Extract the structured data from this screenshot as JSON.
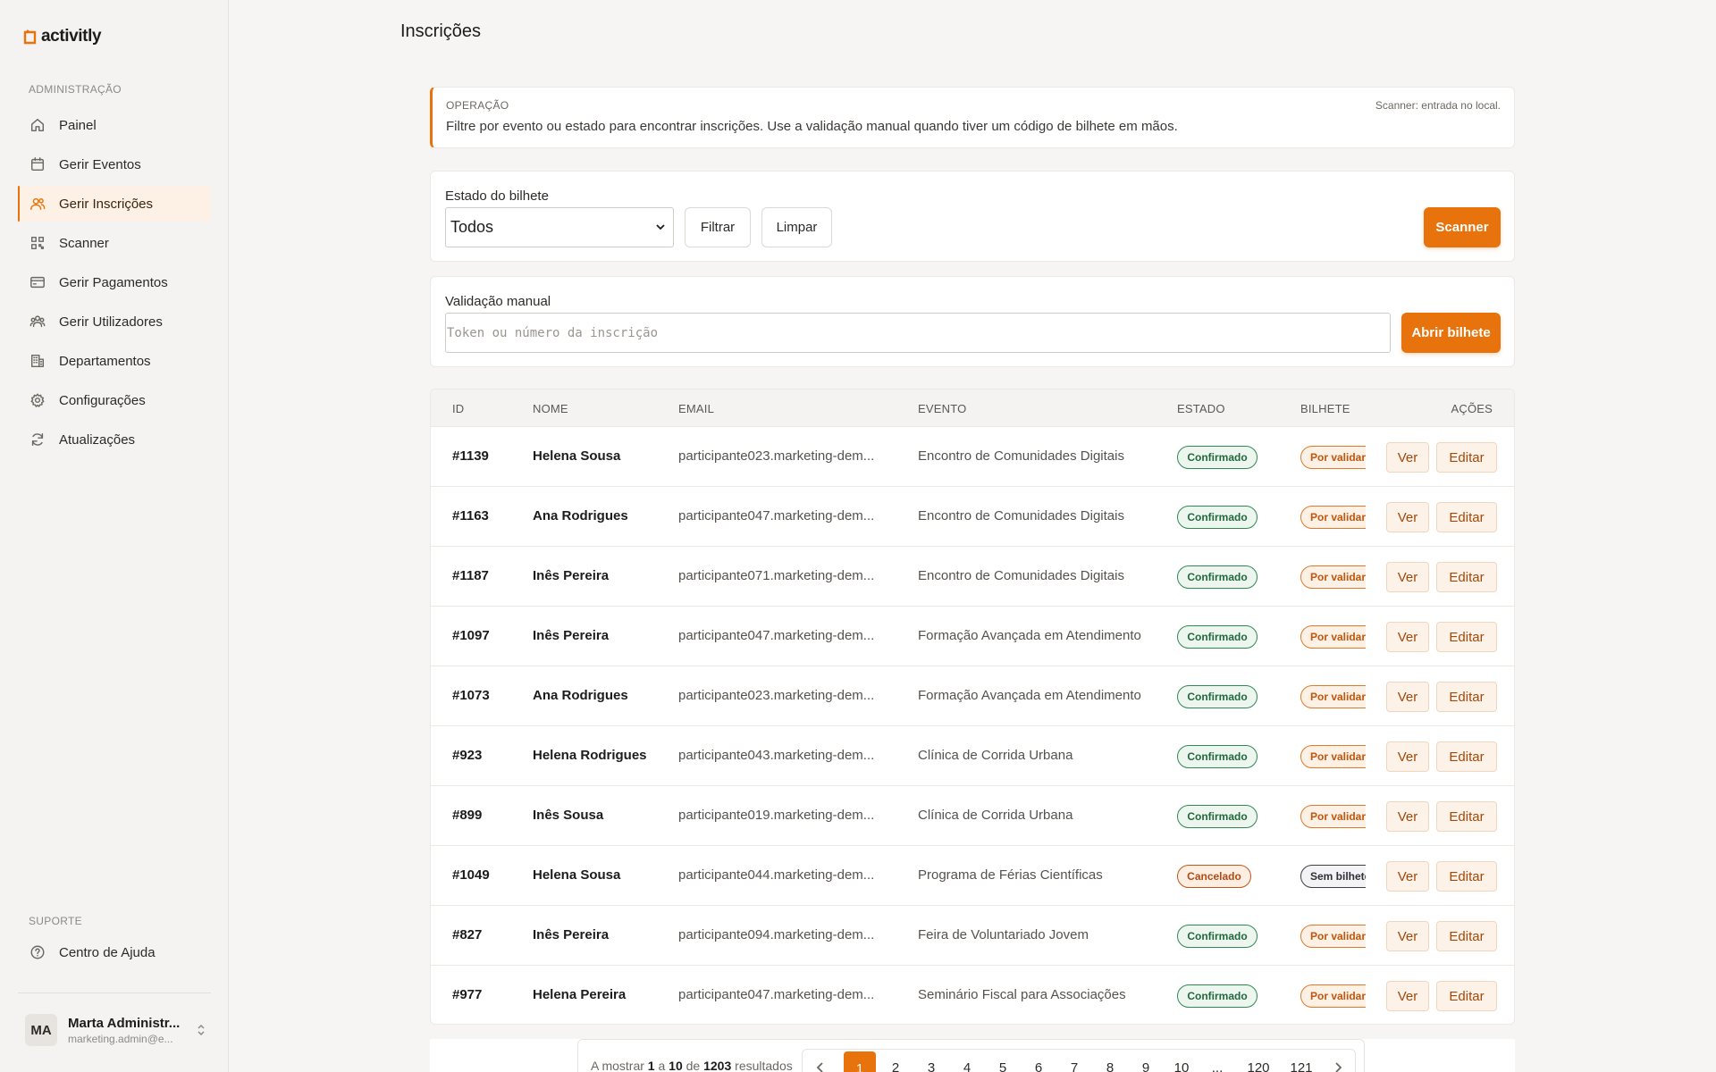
{
  "brand": {
    "name": "activitly",
    "accent": "#e8720c"
  },
  "sidebar": {
    "admin_label": "ADMINISTRAÇÃO",
    "items": [
      {
        "label": "Painel",
        "icon": "home-icon"
      },
      {
        "label": "Gerir Eventos",
        "icon": "calendar-icon"
      },
      {
        "label": "Gerir Inscrições",
        "icon": "users-icon"
      },
      {
        "label": "Scanner",
        "icon": "qr-icon"
      },
      {
        "label": "Gerir Pagamentos",
        "icon": "credit-card-icon"
      },
      {
        "label": "Gerir Utilizadores",
        "icon": "user-group-icon"
      },
      {
        "label": "Departamentos",
        "icon": "building-icon"
      },
      {
        "label": "Configurações",
        "icon": "gear-icon"
      },
      {
        "label": "Atualizações",
        "icon": "refresh-icon"
      }
    ],
    "support_label": "SUPORTE",
    "help": {
      "label": "Centro de Ajuda",
      "icon": "help-circle-icon"
    },
    "user": {
      "initials": "MA",
      "name": "Marta Administr...",
      "email": "marketing.admin@e..."
    }
  },
  "page": {
    "title": "Inscrições"
  },
  "operation": {
    "label": "OPERAÇÃO",
    "text": "Filtre por evento ou estado para encontrar inscrições. Use a validação manual quando tiver um código de bilhete em mãos.",
    "note": "Scanner: entrada no local."
  },
  "filter": {
    "label": "Estado do bilhete",
    "selected": "Todos",
    "filter_button": "Filtrar",
    "clear_button": "Limpar",
    "scanner_button": "Scanner"
  },
  "validation": {
    "label": "Validação manual",
    "placeholder": "Token ou número da inscrição",
    "button": "Abrir bilhete"
  },
  "table": {
    "headers": {
      "id": "ID",
      "name": "NOME",
      "email": "EMAIL",
      "event": "EVENTO",
      "status": "ESTADO",
      "ticket": "BILHETE",
      "actions": "AÇÕES"
    },
    "view_label": "Ver",
    "edit_label": "Editar",
    "rows": [
      {
        "id": "#1139",
        "name": "Helena Sousa",
        "email": "participante023.marketing-dem...",
        "event": "Encontro de Comunidades Digitais",
        "status": "Confirmado",
        "status_type": "ok",
        "ticket": "Por validar",
        "ticket_type": "pending"
      },
      {
        "id": "#1163",
        "name": "Ana Rodrigues",
        "email": "participante047.marketing-dem...",
        "event": "Encontro de Comunidades Digitais",
        "status": "Confirmado",
        "status_type": "ok",
        "ticket": "Por validar",
        "ticket_type": "pending"
      },
      {
        "id": "#1187",
        "name": "Inês Pereira",
        "email": "participante071.marketing-dem...",
        "event": "Encontro de Comunidades Digitais",
        "status": "Confirmado",
        "status_type": "ok",
        "ticket": "Por validar",
        "ticket_type": "pending"
      },
      {
        "id": "#1097",
        "name": "Inês Pereira",
        "email": "participante047.marketing-dem...",
        "event": "Formação Avançada em Atendimento",
        "status": "Confirmado",
        "status_type": "ok",
        "ticket": "Por validar",
        "ticket_type": "pending"
      },
      {
        "id": "#1073",
        "name": "Ana Rodrigues",
        "email": "participante023.marketing-dem...",
        "event": "Formação Avançada em Atendimento",
        "status": "Confirmado",
        "status_type": "ok",
        "ticket": "Por validar",
        "ticket_type": "pending"
      },
      {
        "id": "#923",
        "name": "Helena Rodrigues",
        "email": "participante043.marketing-dem...",
        "event": "Clínica de Corrida Urbana",
        "status": "Confirmado",
        "status_type": "ok",
        "ticket": "Por validar",
        "ticket_type": "pending"
      },
      {
        "id": "#899",
        "name": "Inês Sousa",
        "email": "participante019.marketing-dem...",
        "event": "Clínica de Corrida Urbana",
        "status": "Confirmado",
        "status_type": "ok",
        "ticket": "Por validar",
        "ticket_type": "pending"
      },
      {
        "id": "#1049",
        "name": "Helena Sousa",
        "email": "participante044.marketing-dem...",
        "event": "Programa de Férias Científicas",
        "status": "Cancelado",
        "status_type": "cancel",
        "ticket": "Sem bilhete",
        "ticket_type": "none"
      },
      {
        "id": "#827",
        "name": "Inês Pereira",
        "email": "participante094.marketing-dem...",
        "event": "Feira de Voluntariado Jovem",
        "status": "Confirmado",
        "status_type": "ok",
        "ticket": "Por validar",
        "ticket_type": "pending"
      },
      {
        "id": "#977",
        "name": "Helena Pereira",
        "email": "participante047.marketing-dem...",
        "event": "Seminário Fiscal para Associações",
        "status": "Confirmado",
        "status_type": "ok",
        "ticket": "Por validar",
        "ticket_type": "pending"
      }
    ]
  },
  "pagination": {
    "prefix": "A mostrar",
    "from": "1",
    "to_word": "a",
    "to": "10",
    "of_word": "de",
    "total": "1203",
    "suffix": "resultados",
    "pages": [
      "1",
      "2",
      "3",
      "4",
      "5",
      "6",
      "7",
      "8",
      "9",
      "10",
      "...",
      "120",
      "121"
    ],
    "current": "1"
  }
}
